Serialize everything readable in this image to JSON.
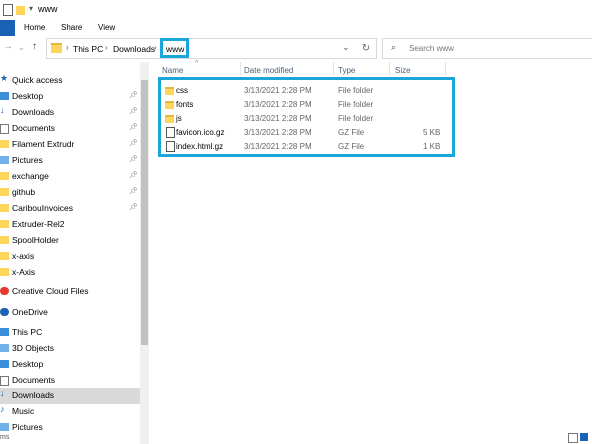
{
  "window": {
    "title": "www"
  },
  "ribbon": {
    "tabs": [
      "Home",
      "Share",
      "View"
    ]
  },
  "address": {
    "crumbs": [
      "This PC",
      "Downloads",
      "www"
    ]
  },
  "search": {
    "placeholder": "Search www"
  },
  "columns": {
    "name": "Name",
    "date": "Date modified",
    "type": "Type",
    "size": "Size"
  },
  "nav": {
    "quick_access": "Quick access",
    "items": [
      {
        "label": "Desktop",
        "pinned": true
      },
      {
        "label": "Downloads",
        "pinned": true
      },
      {
        "label": "Documents",
        "pinned": true
      },
      {
        "label": "Filament Extrudr",
        "pinned": true
      },
      {
        "label": "Pictures",
        "pinned": true
      },
      {
        "label": "exchange",
        "pinned": true
      },
      {
        "label": "github",
        "pinned": true
      },
      {
        "label": "CaribouInvoices",
        "pinned": true
      },
      {
        "label": "Extruder-Rel2",
        "pinned": false
      },
      {
        "label": "SpoolHolder",
        "pinned": false
      },
      {
        "label": "x-axis",
        "pinned": false
      },
      {
        "label": "x-Axis",
        "pinned": false
      }
    ],
    "creative_cloud": "Creative Cloud Files",
    "onedrive": "OneDrive",
    "this_pc": "This PC",
    "pc_items": [
      "3D Objects",
      "Desktop",
      "Documents",
      "Downloads",
      "Music",
      "Pictures"
    ]
  },
  "files": [
    {
      "name": "css",
      "date": "3/13/2021 2:28 PM",
      "type": "File folder",
      "size": "",
      "kind": "folder"
    },
    {
      "name": "fonts",
      "date": "3/13/2021 2:28 PM",
      "type": "File folder",
      "size": "",
      "kind": "folder"
    },
    {
      "name": "js",
      "date": "3/13/2021 2:28 PM",
      "type": "File folder",
      "size": "",
      "kind": "folder"
    },
    {
      "name": "favicon.ico.gz",
      "date": "3/13/2021 2:28 PM",
      "type": "GZ File",
      "size": "5 KB",
      "kind": "file"
    },
    {
      "name": "index.html.gz",
      "date": "3/13/2021 2:28 PM",
      "type": "GZ File",
      "size": "1 KB",
      "kind": "file"
    }
  ],
  "status": {
    "text": "ms"
  },
  "colors": {
    "accent": "#1aa6d9",
    "selected_nav": "#cce8ff"
  }
}
